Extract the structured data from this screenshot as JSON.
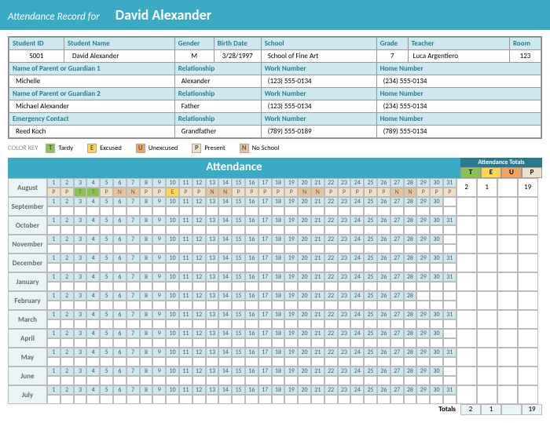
{
  "banner": {
    "label": "Attendance Record for",
    "name": "David Alexander"
  },
  "info_headers": {
    "student_id": "Student ID",
    "student_name": "Student Name",
    "gender": "Gender",
    "birth_date": "Birth Date",
    "school": "School",
    "grade": "Grade",
    "teacher": "Teacher",
    "room": "Room",
    "g1": "Name of Parent or Guardian 1",
    "rel": "Relationship",
    "work": "Work Number",
    "home": "Home Number",
    "g2": "Name of Parent or Guardian 2",
    "em": "Emergency Contact"
  },
  "student": {
    "id": "S001",
    "name": "David Alexander",
    "gender": "M",
    "birth": "3/28/1997",
    "school": "School of Fine Art",
    "grade": "7",
    "teacher": "Luca Argentiero",
    "room": "123"
  },
  "g1": {
    "name": "Michelle",
    "rel": "Alexander",
    "work": "(123) 555-0134",
    "home": "(234) 555-0134"
  },
  "g2": {
    "name": "Michael Alexander",
    "rel": "Father",
    "work": "(123) 555-0134",
    "home": "(234) 555-0134"
  },
  "em": {
    "name": "Reed Koch",
    "rel": "Grandfather",
    "work": "(789) 555-0189",
    "home": "(789) 555-0134"
  },
  "key": {
    "label": "COLOR KEY",
    "t": "T",
    "t_lbl": "Tardy",
    "e": "E",
    "e_lbl": "Excused",
    "u": "U",
    "u_lbl": "Unexcused",
    "p": "P",
    "p_lbl": "Present",
    "n": "N",
    "n_lbl": "No School"
  },
  "att": {
    "title": "Attendance",
    "totals_header": "Attendance Totals",
    "cols": {
      "t": "T",
      "e": "E",
      "u": "U",
      "p": "P"
    },
    "col_colors": {
      "t": "#8bc34a",
      "e": "#ffd54f",
      "u": "#f5a35c",
      "p": "#f0e0c8"
    },
    "months": [
      {
        "name": "August",
        "days": 31,
        "marks": [
          "P",
          "P",
          "T",
          "T",
          "P",
          "N",
          "N",
          "P",
          "P",
          "E",
          "P",
          "P",
          "N",
          "N",
          "P",
          "P",
          "P",
          "P",
          "P",
          "N",
          "N",
          "P",
          "P",
          "P",
          "P",
          "P",
          "N",
          "N",
          "P",
          "P",
          "P"
        ],
        "t": "2",
        "e": "1",
        "u": "",
        "p": "19"
      },
      {
        "name": "September",
        "days": 30,
        "marks": [],
        "t": "",
        "e": "",
        "u": "",
        "p": ""
      },
      {
        "name": "October",
        "days": 31,
        "marks": [],
        "t": "",
        "e": "",
        "u": "",
        "p": ""
      },
      {
        "name": "November",
        "days": 30,
        "marks": [],
        "t": "",
        "e": "",
        "u": "",
        "p": ""
      },
      {
        "name": "December",
        "days": 31,
        "marks": [],
        "t": "",
        "e": "",
        "u": "",
        "p": ""
      },
      {
        "name": "January",
        "days": 31,
        "marks": [],
        "t": "",
        "e": "",
        "u": "",
        "p": ""
      },
      {
        "name": "February",
        "days": 28,
        "marks": [],
        "t": "",
        "e": "",
        "u": "",
        "p": ""
      },
      {
        "name": "March",
        "days": 31,
        "marks": [],
        "t": "",
        "e": "",
        "u": "",
        "p": ""
      },
      {
        "name": "April",
        "days": 30,
        "marks": [],
        "t": "",
        "e": "",
        "u": "",
        "p": ""
      },
      {
        "name": "May",
        "days": 31,
        "marks": [],
        "t": "",
        "e": "",
        "u": "",
        "p": ""
      },
      {
        "name": "June",
        "days": 30,
        "marks": [],
        "t": "",
        "e": "",
        "u": "",
        "p": ""
      },
      {
        "name": "July",
        "days": 31,
        "marks": [],
        "t": "",
        "e": "",
        "u": "",
        "p": ""
      }
    ],
    "grand_label": "Totals",
    "grand": {
      "t": "2",
      "e": "1",
      "u": "",
      "p": "19"
    }
  }
}
